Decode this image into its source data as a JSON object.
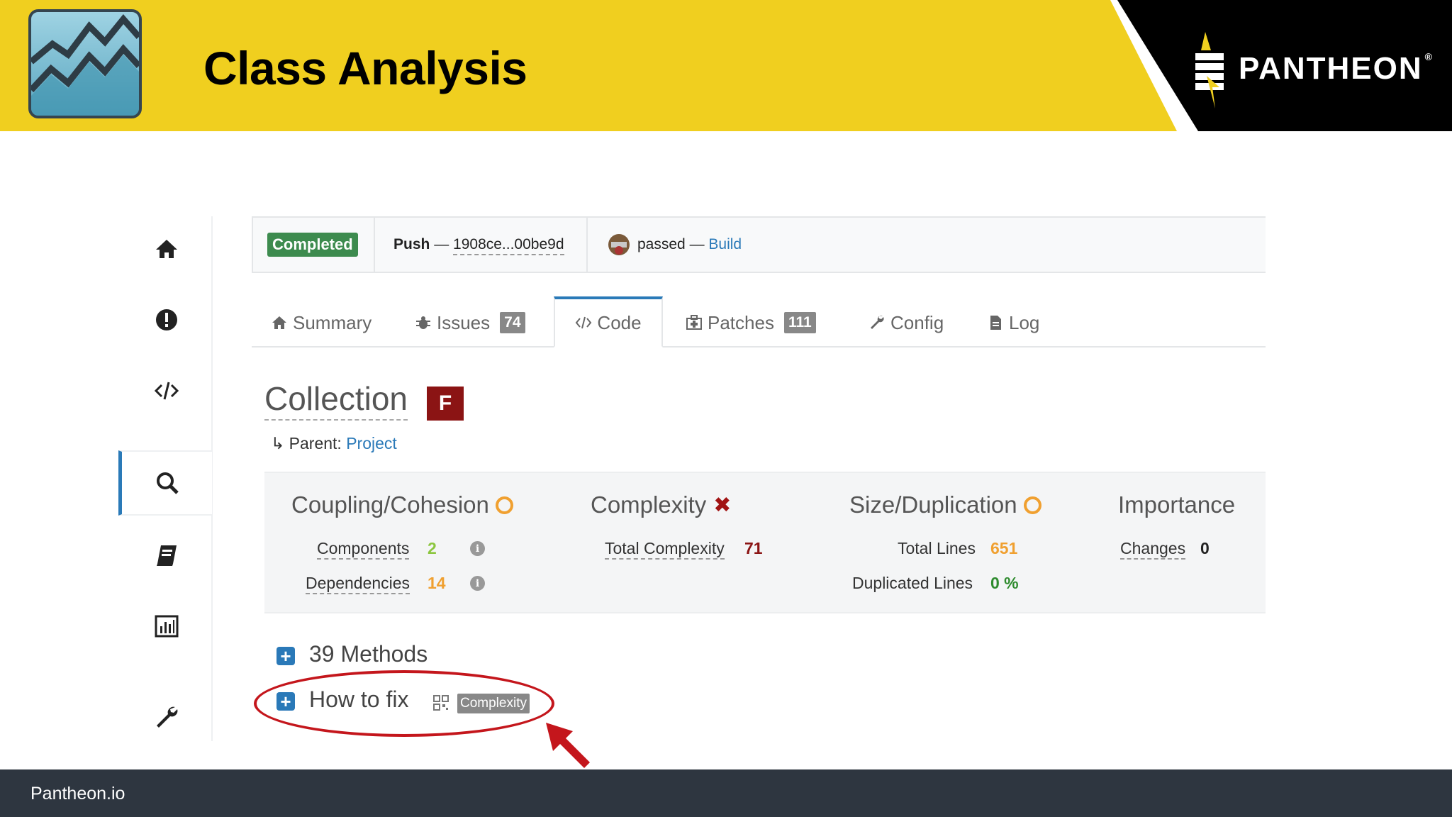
{
  "header": {
    "title": "Class Analysis",
    "brand": "PANTHEON",
    "brand_mark": "®",
    "colors": {
      "yellow": "#f0cf1f",
      "black": "#000000"
    }
  },
  "footer": {
    "text": "Pantheon.io"
  },
  "sidebar": {
    "items": [
      {
        "icon": "home-icon"
      },
      {
        "icon": "exclamation-icon"
      },
      {
        "icon": "code-icon"
      },
      {
        "icon": "search-icon",
        "active": true
      },
      {
        "icon": "book-icon"
      },
      {
        "icon": "bar-chart-icon"
      },
      {
        "icon": "wrench-icon"
      }
    ]
  },
  "buildbar": {
    "status": "Completed",
    "push_label": "Push",
    "dash": "—",
    "commit": "1908ce...00be9d",
    "result": "passed",
    "build_link": "Build"
  },
  "tabs": [
    {
      "label": "Summary",
      "icon": "home-icon"
    },
    {
      "label": "Issues",
      "icon": "bug-icon",
      "count": "74"
    },
    {
      "label": "Code",
      "icon": "code-icon",
      "active": true
    },
    {
      "label": "Patches",
      "icon": "medkit-icon",
      "count": "111"
    },
    {
      "label": "Config",
      "icon": "wrench-icon"
    },
    {
      "label": "Log",
      "icon": "file-icon"
    }
  ],
  "collection": {
    "title": "Collection",
    "grade": "F",
    "parent_arrow": "↳",
    "parent_label": "Parent:",
    "parent_link": "Project"
  },
  "metrics": {
    "coupling": {
      "title": "Coupling/Cohesion",
      "components_label": "Components",
      "components_value": "2",
      "dependencies_label": "Dependencies",
      "dependencies_value": "14"
    },
    "complexity": {
      "title": "Complexity",
      "total_label": "Total Complexity",
      "total_value": "71"
    },
    "size": {
      "title": "Size/Duplication",
      "lines_label": "Total Lines",
      "lines_value": "651",
      "dup_label": "Duplicated Lines",
      "dup_value": "0 %"
    },
    "importance": {
      "title": "Importance",
      "changes_label": "Changes",
      "changes_value": "0"
    },
    "status_colors": {
      "green": "#8cc63f",
      "orange": "#f0a030",
      "red": "#8b1414",
      "dup_green": "#2e8b2e"
    }
  },
  "methods": {
    "label": "39 Methods"
  },
  "howtofix": {
    "label": "How to fix",
    "tag": "Complexity"
  }
}
